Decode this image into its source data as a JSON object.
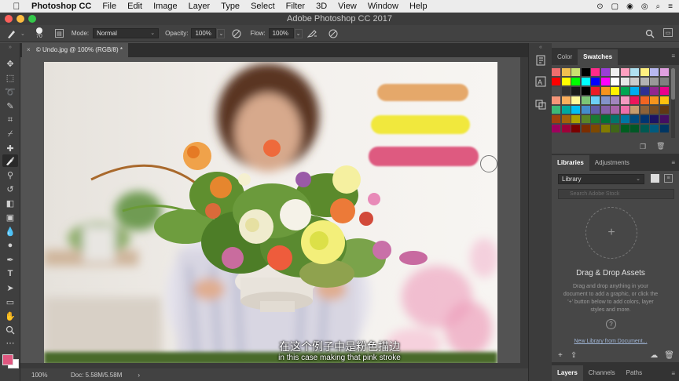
{
  "menubar": {
    "apple": "",
    "app_name": "Photoshop CC",
    "menus": [
      "File",
      "Edit",
      "Image",
      "Layer",
      "Type",
      "Select",
      "Filter",
      "3D",
      "View",
      "Window",
      "Help"
    ],
    "status_icons": [
      "⊙",
      "▢",
      "◉",
      "◎",
      "⌕",
      "≡"
    ]
  },
  "window": {
    "title": "Adobe Photoshop CC 2017"
  },
  "options": {
    "brush_size": "70",
    "mode_label": "Mode:",
    "mode_value": "Normal",
    "opacity_label": "Opacity:",
    "opacity_value": "100%",
    "flow_label": "Flow:",
    "flow_value": "100%"
  },
  "document": {
    "tab_label": "© Undo.jpg @ 100% (RGB/8) *",
    "close_glyph": "×"
  },
  "canvas_image": {
    "stroke_colors": [
      "#e5a86a",
      "#f1e83c",
      "#de5a80"
    ],
    "subtitle_cn": "在这个例子中是粉色描边",
    "subtitle_en": "in this case making that pink stroke"
  },
  "status": {
    "zoom": "100%",
    "doc_info": "Doc: 5.58M/5.58M",
    "arrow": "›"
  },
  "toolbar": {
    "foreground_color": "#e0567f",
    "background_color": "#ffffff"
  },
  "color_panel": {
    "tabs": [
      "Color",
      "Swatches"
    ],
    "active_tab": "Swatches",
    "swatches": [
      "#f06e6e",
      "#f0c050",
      "#c9e070",
      "#000000",
      "#ff2b8a",
      "#9a3ed6",
      "#f0f0f0",
      "#ffa0c0",
      "#b0e0f0",
      "#fff080",
      "#b8b8f0",
      "#e0a0e0",
      "#60e060",
      "#ff0000",
      "#ffff00",
      "#00ff00",
      "#00ffff",
      "#0000ff",
      "#ff00ff",
      "#ffffff",
      "#e6e6e6",
      "#cccccc",
      "#b3b3b3",
      "#999999",
      "#808080",
      "#666666",
      "#4d4d4d",
      "#333333",
      "#1a1a1a",
      "#000000",
      "#ed1c24",
      "#f7941d",
      "#fff200",
      "#00a651",
      "#00aeef",
      "#2e3192",
      "#92278f",
      "#ec008c",
      "#f26c4f",
      "#f69679",
      "#fbaf5d",
      "#fff799",
      "#7cc576",
      "#6dcff6",
      "#8393ca",
      "#a186be",
      "#f49ac1",
      "#ed145b",
      "#f26522",
      "#f7941d",
      "#ffc20e",
      "#a3d39c",
      "#3cb878",
      "#00a99d",
      "#00bff3",
      "#448ccb",
      "#605ca8",
      "#8560a8",
      "#a864a8",
      "#f06eaa",
      "#c69c6d",
      "#8c6239",
      "#754c24",
      "#603913",
      "#9e0b0f",
      "#a0410d",
      "#a36209",
      "#aba000",
      "#598527",
      "#1a7b30",
      "#007236",
      "#00746b",
      "#0076a3",
      "#004b80",
      "#003471",
      "#1b1464",
      "#440e62",
      "#630460",
      "#9e005d",
      "#9e0039",
      "#790000",
      "#7b2e00",
      "#7d4900",
      "#827b00",
      "#406618",
      "#005e20",
      "#005826",
      "#005952",
      "#005b7f",
      "#003663",
      "#002157"
    ]
  },
  "libraries": {
    "tabs": [
      "Libraries",
      "Adjustments"
    ],
    "active_tab": "Libraries",
    "library_name": "Library",
    "search_placeholder": "Search Adobe Stock",
    "drop_title": "Drag & Drop Assets",
    "drop_desc": "Drag and drop anything in your document to add a graphic, or click the '+' button below to add colors, layer styles and more.",
    "help_glyph": "?",
    "new_link": "New Library from Document..."
  },
  "layers_panel": {
    "tabs": [
      "Layers",
      "Channels",
      "Paths"
    ],
    "active_tab": "Layers"
  }
}
